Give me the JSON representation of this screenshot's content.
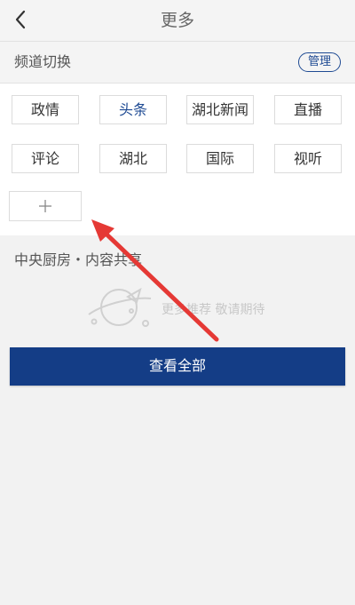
{
  "header": {
    "title": "更多",
    "back_icon": "chevron-left-icon"
  },
  "channel_switch": {
    "label": "频道切换",
    "manage_label": "管理",
    "accent_color": "#1e4a93",
    "channels": [
      {
        "label": "政情",
        "active": false
      },
      {
        "label": "头条",
        "active": true
      },
      {
        "label": "湖北新闻",
        "active": false
      },
      {
        "label": "直播",
        "active": false
      },
      {
        "label": "评论",
        "active": false
      },
      {
        "label": "湖北",
        "active": false
      },
      {
        "label": "国际",
        "active": false
      },
      {
        "label": "视听",
        "active": false
      }
    ],
    "add_icon": "plus-icon"
  },
  "central_kitchen": {
    "title": "中央厨房・内容共享",
    "empty_icon": "rocket-planet-icon",
    "empty_text": "更多推荐 敬请期待",
    "view_all_label": "查看全部",
    "button_color": "#143d86"
  },
  "annotation": {
    "arrow_color": "#e53935"
  }
}
